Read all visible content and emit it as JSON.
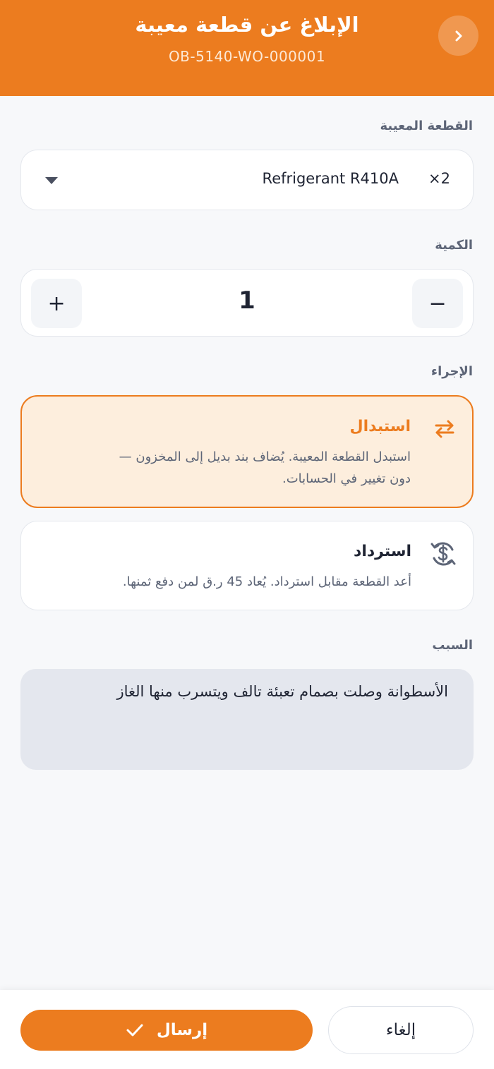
{
  "header": {
    "title": "الإبلاغ عن قطعة معيبة",
    "subtitle": "OB-5140-WO-000001",
    "back_icon": "chevron-right-icon"
  },
  "part": {
    "label": "القطعة المعيبة",
    "selected_name": "Refrigerant R410A",
    "selected_qty": "×2"
  },
  "quantity": {
    "label": "الكمية",
    "value": "1",
    "minus": "−",
    "plus": "+"
  },
  "action": {
    "label": "الإجراء",
    "options": [
      {
        "title": "استبدال",
        "desc_line1": "استبدل القطعة المعيبة. يُضاف بند بديل إلى المخزون —",
        "desc_line2": "دون تغيير في الحسابات.",
        "icon": "swap-arrows-icon",
        "selected": true
      },
      {
        "title": "استرداد",
        "desc_line1": "أعد القطعة مقابل استرداد. يُعاد 45 ر.ق لمن دفع ثمنها.",
        "icon": "refund-dollar-icon",
        "selected": false
      }
    ]
  },
  "reason": {
    "label": "السبب",
    "value": "الأسطوانة وصلت بصمام تعبئة تالف ويتسرب منها الغاز"
  },
  "footer": {
    "submit_label": "إرسال",
    "cancel_label": "إلغاء"
  },
  "colors": {
    "accent": "#ec7c1f",
    "selected_bg": "#fdeedd"
  }
}
